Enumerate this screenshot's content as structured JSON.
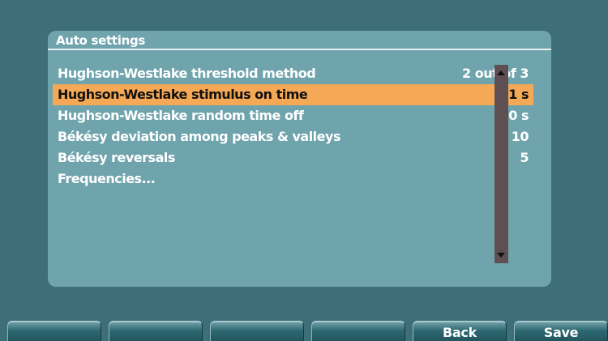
{
  "panel": {
    "title": "Auto settings"
  },
  "settings": [
    {
      "label": "Hughson-Westlake threshold method",
      "value": "2 out of 3",
      "selected": false
    },
    {
      "label": "Hughson-Westlake stimulus on time",
      "value": "1 s",
      "selected": true
    },
    {
      "label": "Hughson-Westlake random time off",
      "value": "0.0 s",
      "selected": false
    },
    {
      "label": "Békésy deviation among peaks & valleys",
      "value": "10",
      "selected": false
    },
    {
      "label": "Békésy reversals",
      "value": "5",
      "selected": false
    },
    {
      "label": "Frequencies...",
      "value": "",
      "selected": false
    }
  ],
  "softkeys": [
    {
      "label": ""
    },
    {
      "label": ""
    },
    {
      "label": ""
    },
    {
      "label": ""
    },
    {
      "label": "Back"
    },
    {
      "label": "Save"
    }
  ],
  "colors": {
    "background": "#3e6f78",
    "panel": "#6fa4ad",
    "selected_row": "#f5a855",
    "scrollbar": "#5e5052"
  }
}
